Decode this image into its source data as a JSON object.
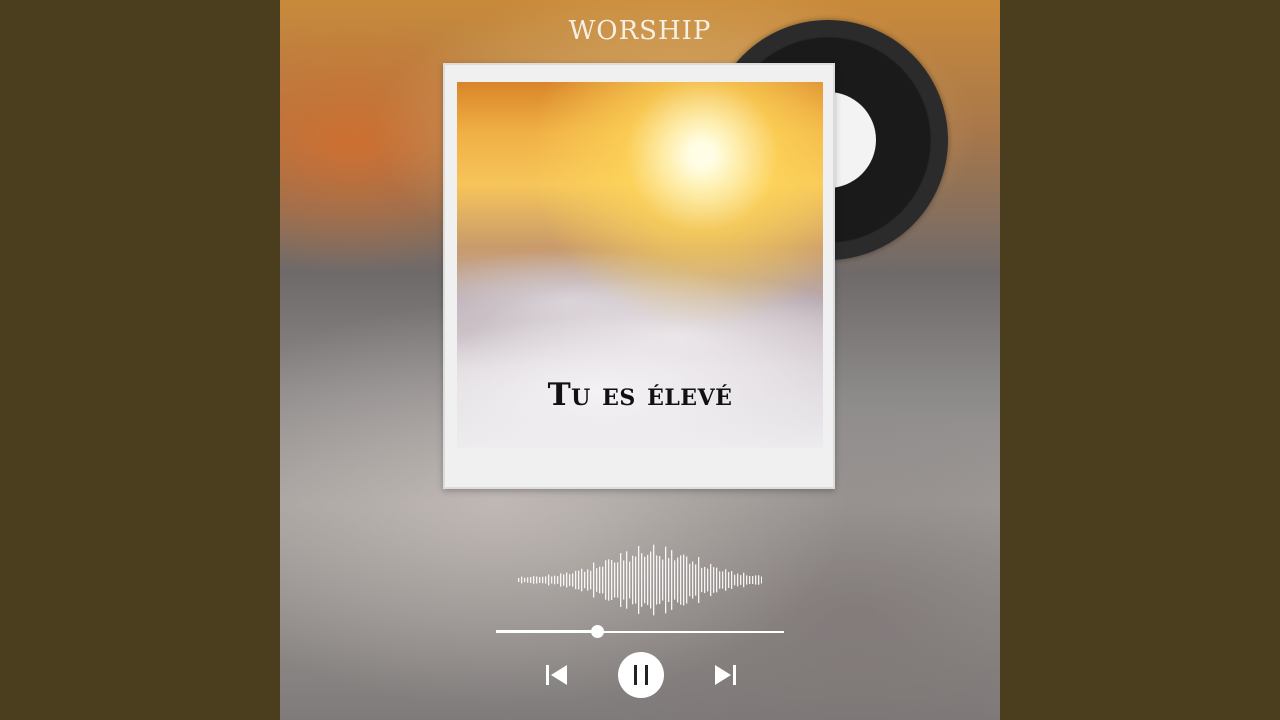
{
  "brand": {
    "name": "WORSHIP"
  },
  "album": {
    "title": "Tu es élevé"
  },
  "player": {
    "progress": 0.35,
    "state": "playing",
    "controls": {
      "previous_icon": "skip-previous-icon",
      "pause_icon": "pause-icon",
      "next_icon": "skip-next-icon"
    }
  },
  "colors": {
    "letterbox": "#4a3e1e",
    "controls": "#ffffff",
    "title_text": "#111111"
  }
}
